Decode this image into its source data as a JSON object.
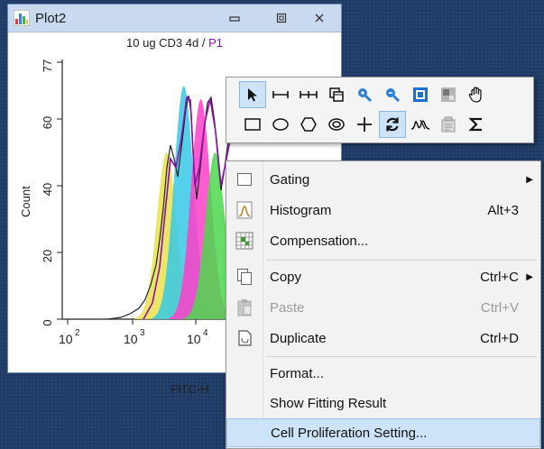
{
  "window": {
    "title": "Plot2",
    "colors": {
      "titlebar": "#c9d9ef",
      "background": "#1f3a63"
    }
  },
  "plot": {
    "title_main": "10 ug CD3 4d / ",
    "title_gate": "P1",
    "ylabel": "Count",
    "xlabel": "FITC-H",
    "yticks": [
      "0",
      "20",
      "40",
      "60",
      "77"
    ],
    "xticks": [
      "10",
      "2",
      "10",
      "3",
      "10",
      "4"
    ]
  },
  "toolbar": {
    "row1": [
      "pointer-icon",
      "range-gate-icon",
      "bi-range-gate-icon",
      "overlay-icon",
      "zoom-in-icon",
      "zoom-out-icon",
      "scale-icon",
      "quadrant-icon",
      "pan-hand-icon"
    ],
    "row2": [
      "rectangle-gate-icon",
      "ellipse-gate-icon",
      "polygon-gate-icon",
      "freehand-gate-icon",
      "crosshair-icon",
      "refresh-icon",
      "fitting-icon",
      "statistics-icon",
      "sum-icon"
    ]
  },
  "menu": {
    "items": [
      {
        "label": "Gating",
        "shortcut": "",
        "submenu": true
      },
      {
        "label": "Histogram",
        "shortcut": "Alt+3"
      },
      {
        "label": "Compensation...",
        "shortcut": ""
      },
      {
        "label": "Copy",
        "shortcut": "Ctrl+C",
        "submenu": true
      },
      {
        "label": "Paste",
        "shortcut": "Ctrl+V",
        "disabled": true
      },
      {
        "label": "Duplicate",
        "shortcut": "Ctrl+D"
      },
      {
        "label": "Format...",
        "shortcut": ""
      },
      {
        "label": "Show Fitting Result",
        "shortcut": ""
      },
      {
        "label": "Cell Proliferation Setting...",
        "shortcut": "",
        "highlighted": true
      }
    ]
  },
  "chart_data": {
    "type": "area",
    "title": "10 ug CD3 4d / P1",
    "xlabel": "FITC-H",
    "ylabel": "Count",
    "x_scale": "log",
    "ylim": [
      0,
      77
    ],
    "series": [
      {
        "color": "#e8e24a",
        "peak_x": 3500,
        "peak_y": 50
      },
      {
        "color": "#37c8e6",
        "peak_x": 6500,
        "peak_y": 70
      },
      {
        "color": "#ff3ec8",
        "peak_x": 12000,
        "peak_y": 66
      },
      {
        "color": "#4cd84c",
        "peak_x": 20000,
        "peak_y": 50
      }
    ]
  }
}
